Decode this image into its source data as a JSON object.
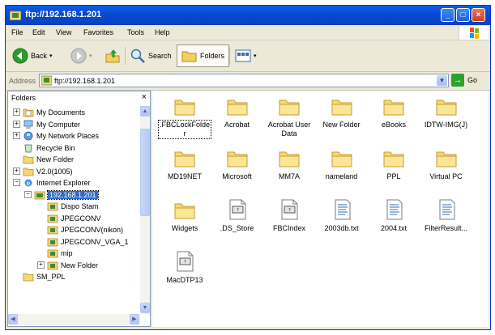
{
  "window": {
    "title": "ftp://192.168.1.201",
    "minimize_label": "_",
    "maximize_label": "□",
    "close_label": "×"
  },
  "menu": [
    "File",
    "Edit",
    "View",
    "Favorites",
    "Tools",
    "Help"
  ],
  "toolbar": {
    "back_label": "Back",
    "search_label": "Search",
    "folders_label": "Folders"
  },
  "address": {
    "label": "Address",
    "value": "ftp://192.168.1.201",
    "go_label": "Go"
  },
  "folders_pane": {
    "title": "Folders",
    "close_label": "×",
    "tree": [
      {
        "label": "My Documents",
        "icon": "documents-icon",
        "expander": "+"
      },
      {
        "label": "My Computer",
        "icon": "computer-icon",
        "expander": "+"
      },
      {
        "label": "My Network Places",
        "icon": "network-icon",
        "expander": "+"
      },
      {
        "label": "Recycle Bin",
        "icon": "recycle-bin-icon",
        "expander": ""
      },
      {
        "label": "New Folder",
        "icon": "folder-icon",
        "expander": ""
      },
      {
        "label": "V2.0(1005)",
        "icon": "folder-icon",
        "expander": "+"
      },
      {
        "label": "Internet Explorer",
        "icon": "internet-explorer-icon",
        "expander": "−"
      },
      {
        "label": "192.168.1.201",
        "icon": "ftp-server-icon",
        "expander": "−"
      },
      {
        "label": "Dispo Stam",
        "icon": "ftp-folder-icon",
        "expander": ""
      },
      {
        "label": "JPEGCONV",
        "icon": "ftp-folder-icon",
        "expander": ""
      },
      {
        "label": "JPEGCONV(nikon)",
        "icon": "ftp-folder-icon",
        "expander": ""
      },
      {
        "label": "JPEGCONV_VGA_1",
        "icon": "ftp-folder-icon",
        "expander": ""
      },
      {
        "label": "mip",
        "icon": "ftp-folder-icon",
        "expander": ""
      },
      {
        "label": "New Folder",
        "icon": "ftp-folder-icon",
        "expander": "+"
      },
      {
        "label": "SM_PPL",
        "icon": "folder-icon",
        "expander": ""
      }
    ]
  },
  "files": [
    {
      "name": ".FBCLockFolder",
      "type": "folder"
    },
    {
      "name": "Acrobat",
      "type": "folder"
    },
    {
      "name": "Acrobat User Data",
      "type": "folder"
    },
    {
      "name": "New Folder",
      "type": "folder"
    },
    {
      "name": "eBooks",
      "type": "folder"
    },
    {
      "name": "IDTW-IMG(J)",
      "type": "folder"
    },
    {
      "name": "MD19NET",
      "type": "folder"
    },
    {
      "name": "Microsoft",
      "type": "folder"
    },
    {
      "name": "MM7A",
      "type": "folder"
    },
    {
      "name": "nameland",
      "type": "folder"
    },
    {
      "name": "PPL",
      "type": "folder"
    },
    {
      "name": "Virtual PC",
      "type": "folder"
    },
    {
      "name": "Widgets",
      "type": "folder"
    },
    {
      "name": ".DS_Store",
      "type": "file"
    },
    {
      "name": "FBCIndex",
      "type": "file"
    },
    {
      "name": "2003db.txt",
      "type": "text"
    },
    {
      "name": "2004.txt",
      "type": "text"
    },
    {
      "name": "FilterResult...",
      "type": "text"
    },
    {
      "name": "MacDTP13",
      "type": "file"
    }
  ]
}
